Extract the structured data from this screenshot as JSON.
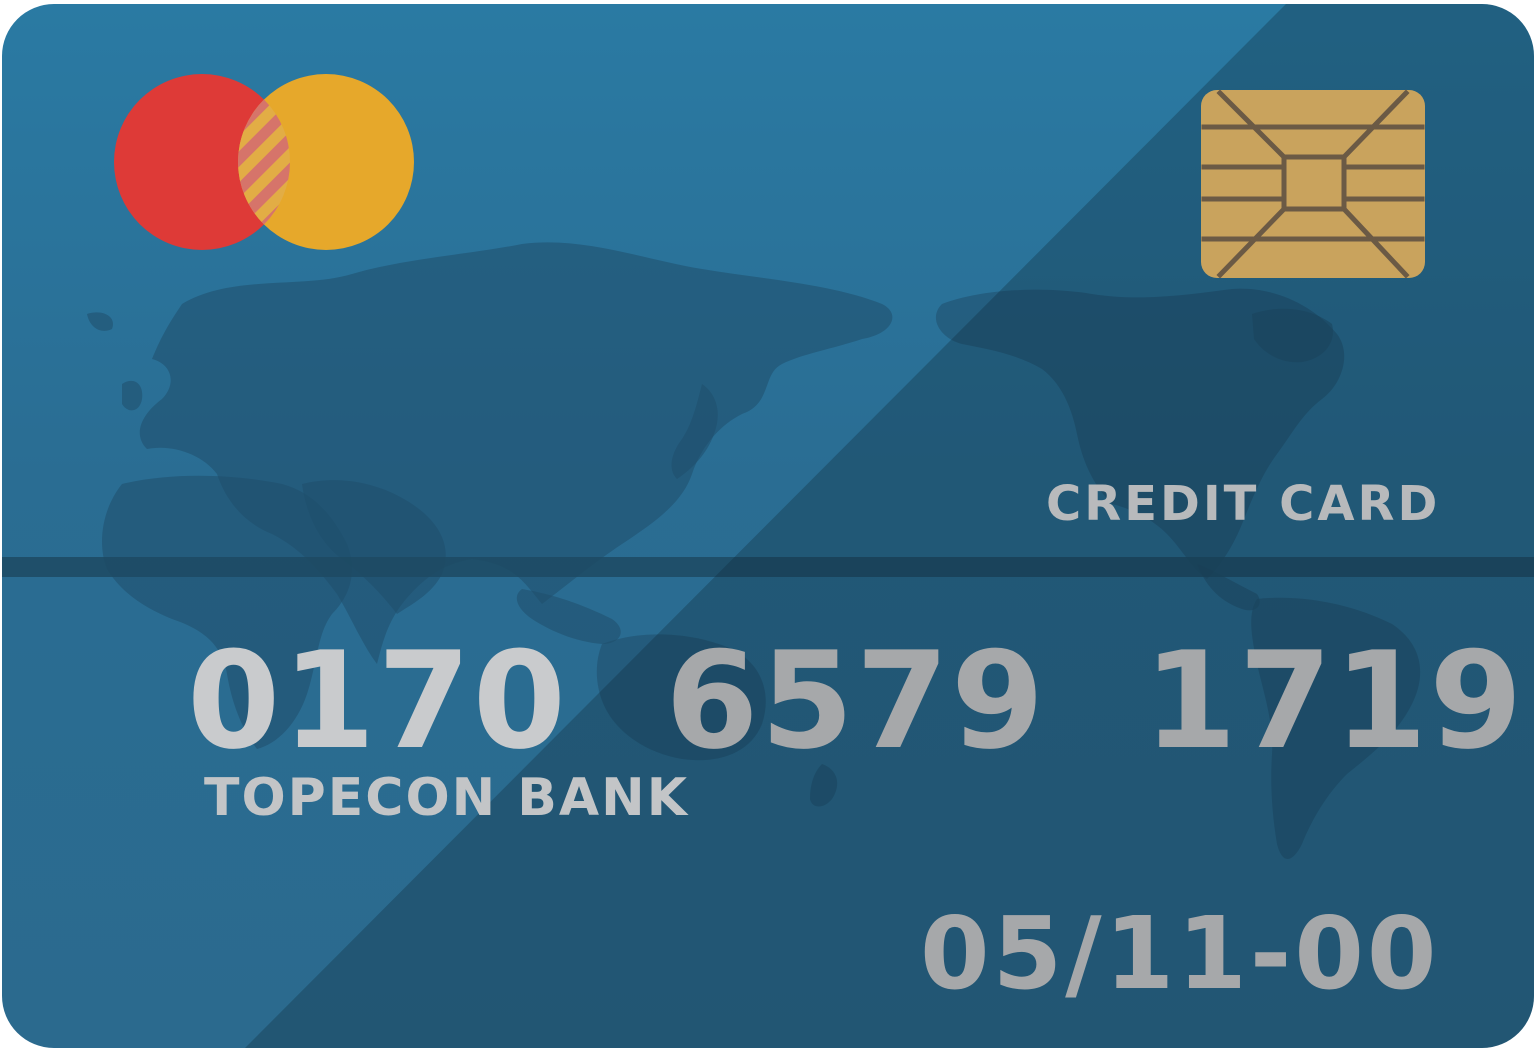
{
  "card": {
    "type_label": "CREDIT CARD",
    "number_groups": [
      "0170",
      "6579",
      "1719"
    ],
    "bank_name": "TOPECON BANK",
    "expiry": "05/11-00"
  },
  "icons": {
    "brand_logo": "overlapping-circles-logo",
    "chip": "emv-chip-icon",
    "background": "world-map"
  },
  "colors": {
    "card_blue": "#2a6d93",
    "logo_red": "#de3a37",
    "logo_yellow": "#e6a82b",
    "chip_gold": "#c9a35d",
    "text_gray": "#a6a8aa"
  }
}
